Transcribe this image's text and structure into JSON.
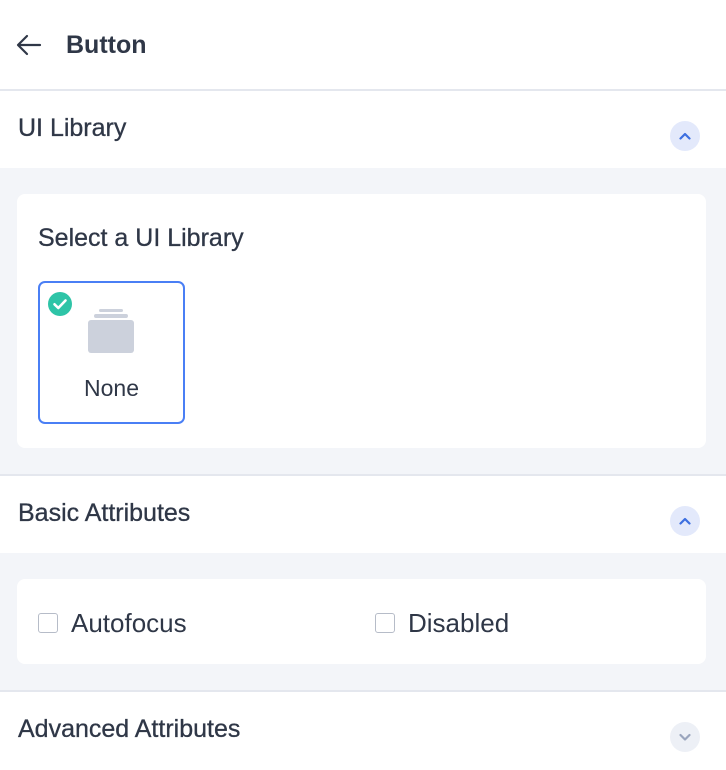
{
  "header": {
    "back_icon": "arrow-left-icon",
    "title": "Button"
  },
  "sections": {
    "ui_library": {
      "title": "UI Library",
      "state": "expanded",
      "toggle_icon": "chevron-up-icon",
      "card_title": "Select a UI Library",
      "options": [
        {
          "label": "None",
          "selected": true,
          "icon": "stack-icon",
          "badge_icon": "check-circle-icon"
        }
      ]
    },
    "basic_attributes": {
      "title": "Basic Attributes",
      "state": "expanded",
      "toggle_icon": "chevron-up-icon",
      "checkboxes": [
        {
          "label": "Autofocus",
          "checked": false
        },
        {
          "label": "Disabled",
          "checked": false
        }
      ]
    },
    "advanced_attributes": {
      "title": "Advanced Attributes",
      "state": "collapsed",
      "toggle_icon": "chevron-down-icon"
    }
  },
  "colors": {
    "accent": "#4a7ff5",
    "selected_check": "#2ec4a7",
    "section_bg": "#f3f5f9",
    "text": "#2f3747"
  }
}
